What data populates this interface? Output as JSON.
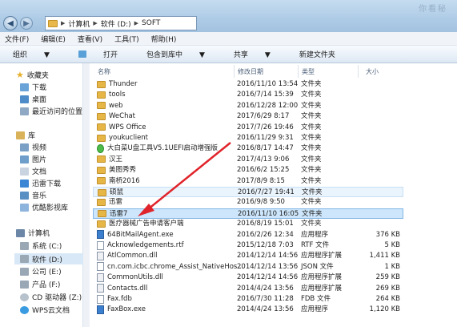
{
  "watermark": "你看秘",
  "address": {
    "segments": [
      "计算机",
      "软件 (D:)",
      "SOFT"
    ]
  },
  "menu": [
    "文件(F)",
    "编辑(E)",
    "查看(V)",
    "工具(T)",
    "帮助(H)"
  ],
  "toolbar": {
    "organize": "组织",
    "open": "打开",
    "include": "包含到库中",
    "share": "共享",
    "new_folder": "新建文件夹"
  },
  "sidebar": {
    "favorites": "收藏夹",
    "fav_items": [
      "下载",
      "桌面",
      "最近访问的位置"
    ],
    "libraries": "库",
    "lib_items": [
      "视频",
      "图片",
      "文档",
      "迅雷下载",
      "音乐",
      "优酷影视库"
    ],
    "computer": "计算机",
    "drives": [
      "系统 (C:)",
      "软件 (D:)",
      "公司 (E:)",
      "产品 (F:)",
      "CD 驱动器 (Z:)",
      "WPS云文档"
    ]
  },
  "columns": {
    "name": "名称",
    "date": "修改日期",
    "type": "类型",
    "size": "大小"
  },
  "files": [
    {
      "name": "Thunder",
      "date": "2016/11/10 13:54",
      "type": "文件夹",
      "size": "",
      "kind": "folder"
    },
    {
      "name": "tools",
      "date": "2016/7/14 15:39",
      "type": "文件夹",
      "size": "",
      "kind": "folder"
    },
    {
      "name": "web",
      "date": "2016/12/28 12:00",
      "type": "文件夹",
      "size": "",
      "kind": "folder"
    },
    {
      "name": "WeChat",
      "date": "2017/6/29 8:17",
      "type": "文件夹",
      "size": "",
      "kind": "folder"
    },
    {
      "name": "WPS Office",
      "date": "2017/7/26 19:46",
      "type": "文件夹",
      "size": "",
      "kind": "folder"
    },
    {
      "name": "youkuclient",
      "date": "2016/11/29 9:31",
      "type": "文件夹",
      "size": "",
      "kind": "folder"
    },
    {
      "name": "大白菜U盘工具V5.1UEFI启动增强版",
      "date": "2016/8/17 14:47",
      "type": "文件夹",
      "size": "",
      "kind": "folder-green"
    },
    {
      "name": "汉王",
      "date": "2017/4/13 9:06",
      "type": "文件夹",
      "size": "",
      "kind": "folder"
    },
    {
      "name": "美图秀秀",
      "date": "2016/6/2 15:25",
      "type": "文件夹",
      "size": "",
      "kind": "folder"
    },
    {
      "name": "南桥2016",
      "date": "2017/8/9 8:15",
      "type": "文件夹",
      "size": "",
      "kind": "folder"
    },
    {
      "name": "硕鼠",
      "date": "2016/7/27 19:41",
      "type": "文件夹",
      "size": "",
      "kind": "folder",
      "state": "hover"
    },
    {
      "name": "迅雷",
      "date": "2016/9/8 9:50",
      "type": "文件夹",
      "size": "",
      "kind": "folder"
    },
    {
      "name": "迅雷7",
      "date": "2016/11/10 16:05",
      "type": "文件夹",
      "size": "",
      "kind": "folder",
      "state": "selected"
    },
    {
      "name": "医疗器械广告申请客户端",
      "date": "2016/8/19 15:01",
      "type": "文件夹",
      "size": "",
      "kind": "folder"
    },
    {
      "name": "64BitMailAgent.exe",
      "date": "2016/2/26 12:34",
      "type": "应用程序",
      "size": "376 KB",
      "kind": "exe"
    },
    {
      "name": "Acknowledgements.rtf",
      "date": "2015/12/18 7:03",
      "type": "RTF 文件",
      "size": "5 KB",
      "kind": "doc"
    },
    {
      "name": "AtlCommon.dll",
      "date": "2014/12/14 14:56",
      "type": "应用程序扩展",
      "size": "1,411 KB",
      "kind": "dll"
    },
    {
      "name": "cn.com.icbc.chrome_Assist_NativeHos...",
      "date": "2014/12/14 13:56",
      "type": "JSON 文件",
      "size": "1 KB",
      "kind": "doc"
    },
    {
      "name": "CommonUtils.dll",
      "date": "2014/12/14 14:56",
      "type": "应用程序扩展",
      "size": "259 KB",
      "kind": "dll"
    },
    {
      "name": "Contacts.dll",
      "date": "2014/4/24 13:56",
      "type": "应用程序扩展",
      "size": "269 KB",
      "kind": "dll"
    },
    {
      "name": "Fax.fdb",
      "date": "2016/7/30 11:28",
      "type": "FDB 文件",
      "size": "264 KB",
      "kind": "doc"
    },
    {
      "name": "FaxBox.exe",
      "date": "2014/4/24 13:56",
      "type": "应用程序",
      "size": "1,120 KB",
      "kind": "exe"
    }
  ],
  "colors": {
    "selection": "#cde6fb",
    "hover": "#eaf4fd",
    "arrow": "#e0242b",
    "folder": "#e6b747"
  }
}
